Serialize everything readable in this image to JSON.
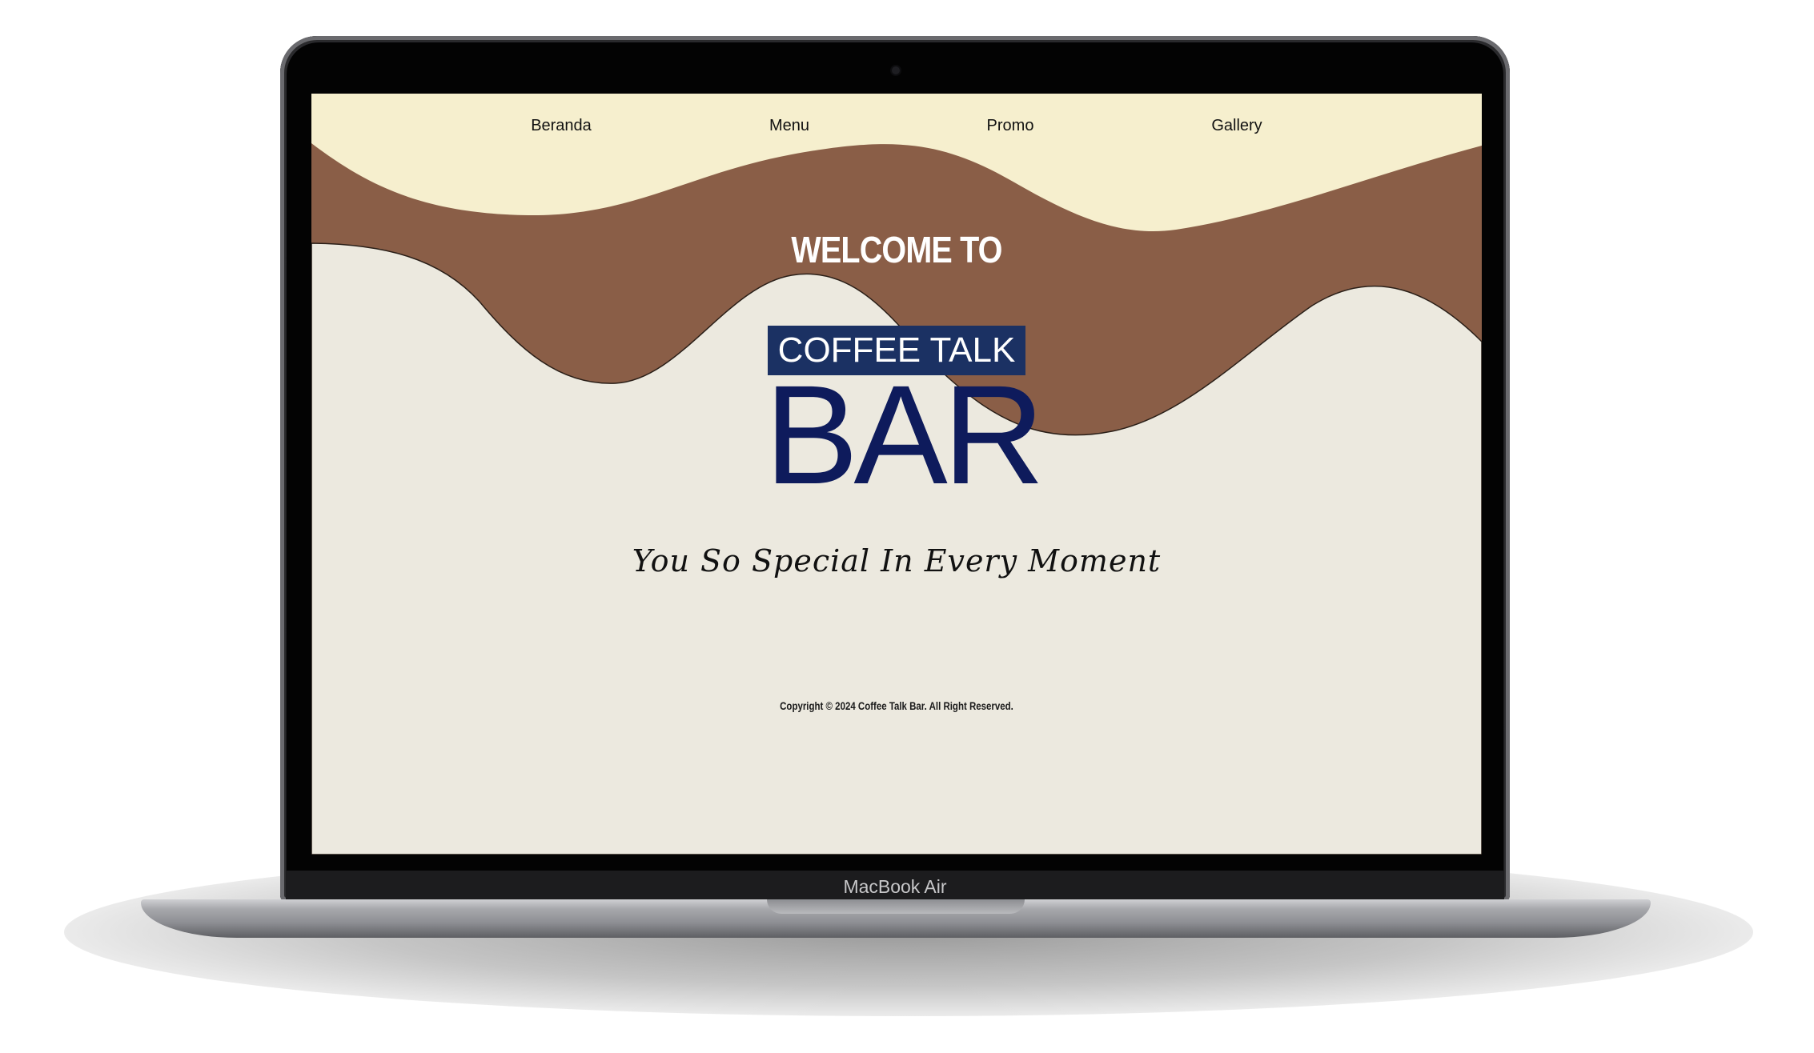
{
  "nav": {
    "items": [
      {
        "label": "Beranda"
      },
      {
        "label": "Menu"
      },
      {
        "label": "Promo"
      },
      {
        "label": "Gallery"
      }
    ]
  },
  "hero": {
    "welcome": "WELCOME TO",
    "logo_top": "COFFEE TALK",
    "logo_bottom": "BAR",
    "tagline": "You So Special In Every Moment"
  },
  "footer": {
    "copyright": "Copyright © 2024 Coffee Talk Bar. All Right Reserved."
  },
  "device": {
    "model_label": "MacBook Air"
  },
  "colors": {
    "page_background": "#ECE9DF",
    "top_band": "#F6EFCE",
    "coffee_wave": "#8A5E47",
    "logo_navy": "#1B3163",
    "logo_text_dark": "#0E1B5C"
  }
}
